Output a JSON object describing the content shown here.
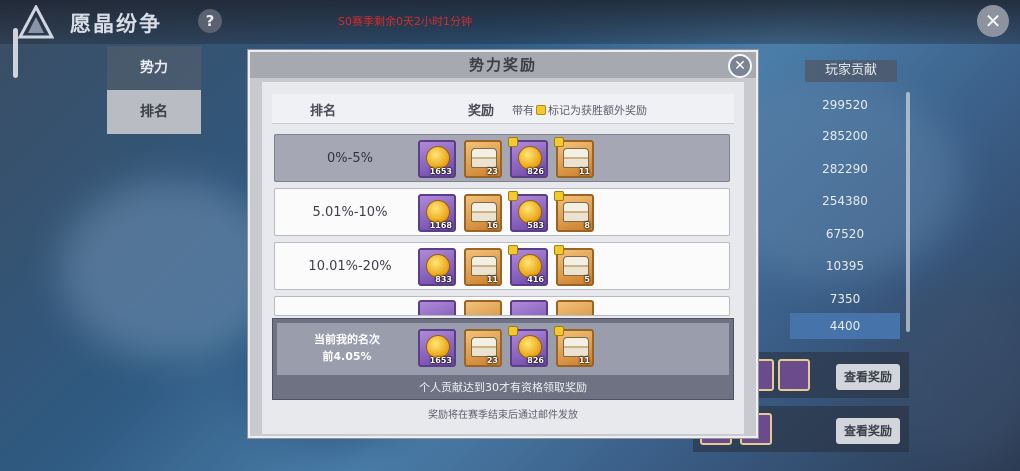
{
  "header": {
    "title": "愿晶纷争",
    "help_icon": "?",
    "season_timer": "S0赛季剩余0天2小时1分钟",
    "close_icon": "✕"
  },
  "sidebar": {
    "items": [
      {
        "label": "势力"
      },
      {
        "label": "排名"
      }
    ]
  },
  "background_table": {
    "column_header": "玩家贡献",
    "scores": [
      "299520",
      "285200",
      "282290",
      "254380",
      "67520",
      "10395",
      "7350",
      "4400"
    ],
    "view_reward_label": "查看奖励"
  },
  "modal": {
    "title": "势力奖励",
    "close_icon": "✕",
    "table_header": {
      "rank": "排名",
      "reward": "奖励",
      "note_prefix": "带有",
      "note_suffix": "标记为获胜额外奖励"
    },
    "rows": [
      {
        "rank": "0%-5%",
        "items": [
          {
            "type": "coin",
            "qty": "1653",
            "bonus": false
          },
          {
            "type": "chest",
            "qty": "23",
            "bonus": false
          },
          {
            "type": "coin",
            "qty": "826",
            "bonus": true
          },
          {
            "type": "chest",
            "qty": "11",
            "bonus": true
          }
        ]
      },
      {
        "rank": "5.01%-10%",
        "items": [
          {
            "type": "coin",
            "qty": "1168",
            "bonus": false
          },
          {
            "type": "chest",
            "qty": "16",
            "bonus": false
          },
          {
            "type": "coin",
            "qty": "583",
            "bonus": true
          },
          {
            "type": "chest",
            "qty": "8",
            "bonus": true
          }
        ]
      },
      {
        "rank": "10.01%-20%",
        "items": [
          {
            "type": "coin",
            "qty": "833",
            "bonus": false
          },
          {
            "type": "chest",
            "qty": "11",
            "bonus": false
          },
          {
            "type": "coin",
            "qty": "416",
            "bonus": true
          },
          {
            "type": "chest",
            "qty": "5",
            "bonus": true
          }
        ]
      }
    ],
    "my_rank": {
      "label_line1": "当前我的名次",
      "label_line2": "前4.05%",
      "items": [
        {
          "type": "coin",
          "qty": "1653",
          "bonus": false
        },
        {
          "type": "chest",
          "qty": "23",
          "bonus": false
        },
        {
          "type": "coin",
          "qty": "826",
          "bonus": true
        },
        {
          "type": "chest",
          "qty": "11",
          "bonus": true
        }
      ],
      "note": "个人贡献达到30才有资格领取奖励"
    },
    "footer_note": "奖励将在赛季结束后通过邮件发放"
  },
  "colors": {
    "accent_blue": "#4773ab",
    "timer_red": "#d22c2c",
    "bonus_gold": "#f3c930"
  }
}
